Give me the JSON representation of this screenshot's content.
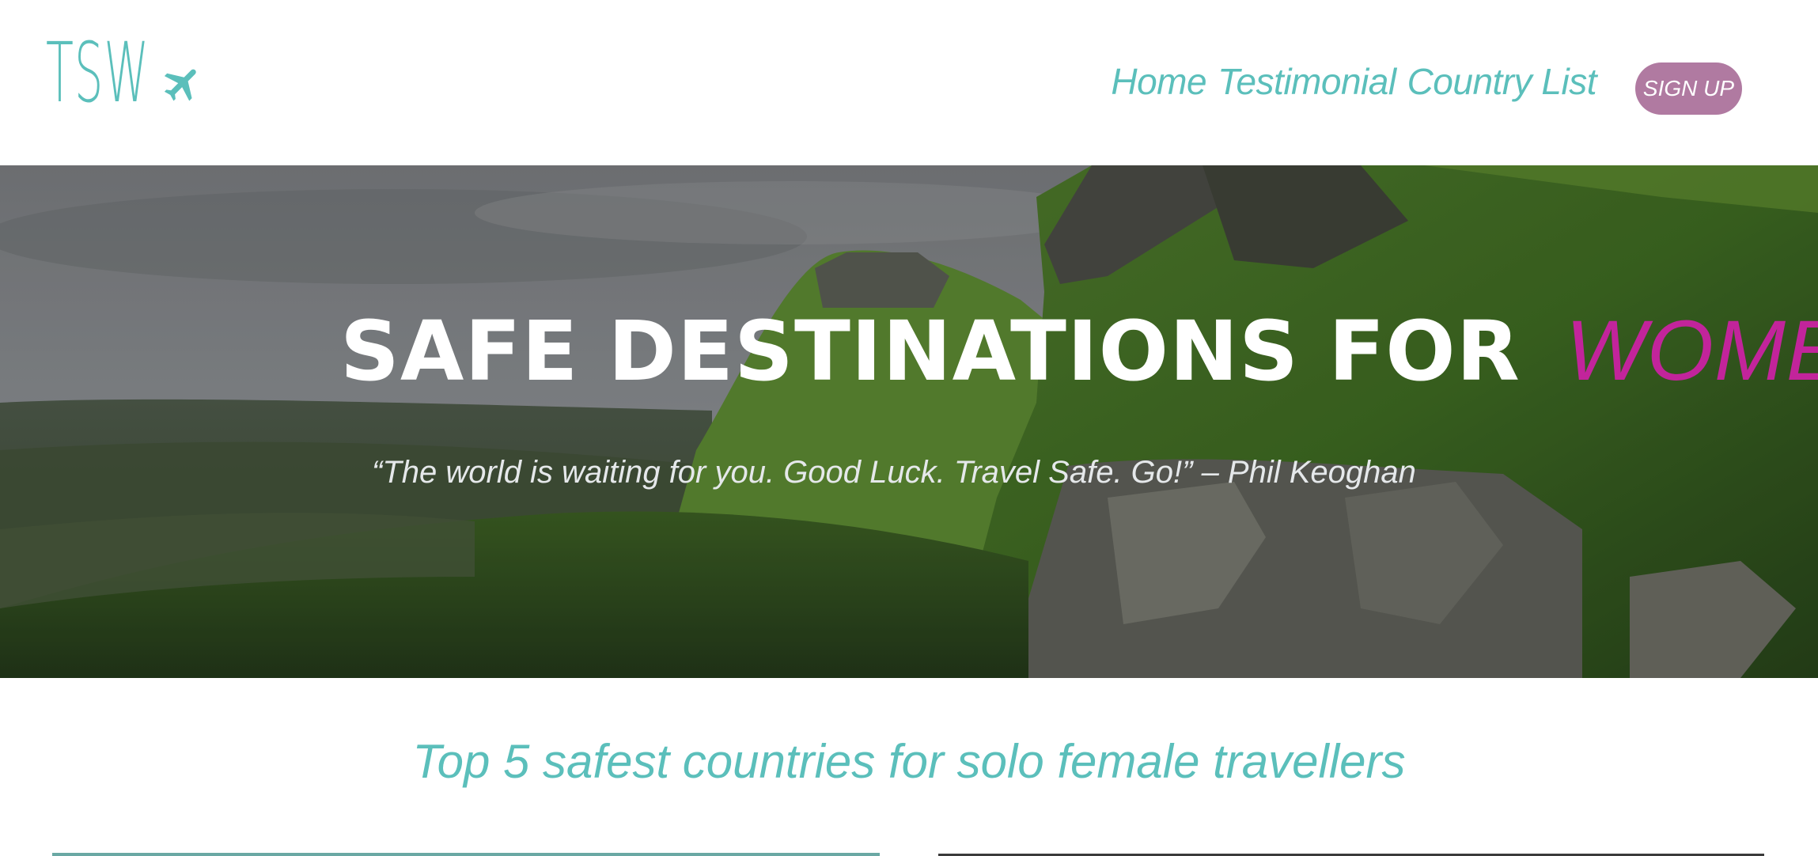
{
  "brand": {
    "logo_text": "TSW",
    "logo_icon": "airplane-icon",
    "accent_color": "#5bbfbb"
  },
  "nav": {
    "items": [
      {
        "label": "Home"
      },
      {
        "label": "Testimonial"
      },
      {
        "label": "Country List"
      }
    ],
    "signup_label": "SIGN UP",
    "signup_color": "#b07aa1"
  },
  "hero": {
    "title_main": "SAFE DESTINATIONS FOR",
    "title_accent": "WOMEN",
    "title_accent_color": "#c2249b",
    "quote": "“The world is waiting for you. Good Luck. Travel Safe. Go!” – Phil Keoghan"
  },
  "content": {
    "section_title": "Top 5 safest countries for solo female travellers"
  }
}
